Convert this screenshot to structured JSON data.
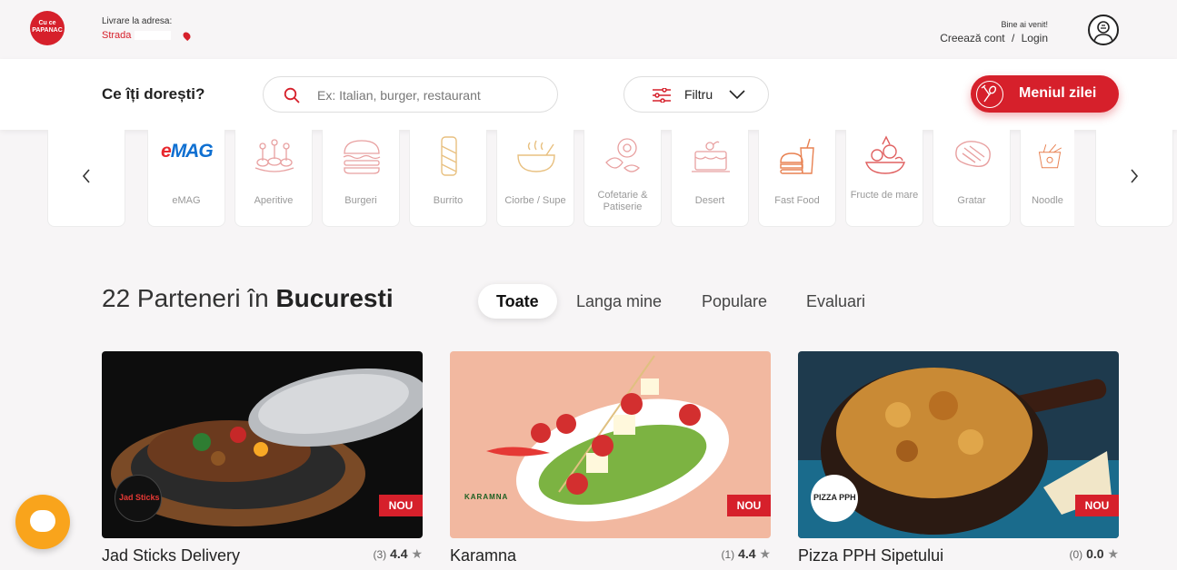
{
  "header": {
    "logo_text": "Cu ce PAPANAC",
    "delivery_label": "Livrare la adresa:",
    "delivery_address": "Strada",
    "welcome": "Bine ai venit!",
    "create_account": "Creează cont",
    "separator": "/",
    "login": "Login"
  },
  "search": {
    "question": "Ce îți dorești?",
    "placeholder": "Ex: Italian, burger, restaurant",
    "filter_label": "Filtru",
    "menu_button": "Meniul zilei"
  },
  "categories": [
    {
      "label": "eMAG",
      "icon": "emag-logo"
    },
    {
      "label": "Aperitive",
      "icon": "appetizer-skewers-icon"
    },
    {
      "label": "Burgeri",
      "icon": "burger-icon"
    },
    {
      "label": "Burrito",
      "icon": "burrito-icon"
    },
    {
      "label": "Ciorbe / Supe",
      "icon": "soup-bowl-icon"
    },
    {
      "label": "Cofetarie & Patiserie",
      "icon": "pastry-icon"
    },
    {
      "label": "Desert",
      "icon": "cake-icon"
    },
    {
      "label": "Fast Food",
      "icon": "fast-food-icon"
    },
    {
      "label": "Fructe de mare",
      "icon": "seafood-icon"
    },
    {
      "label": "Gratar",
      "icon": "steak-icon"
    },
    {
      "label": "Noodle",
      "icon": "noodle-box-icon"
    }
  ],
  "partners": {
    "count_text": "22 Parteneri în",
    "city": "Bucuresti",
    "tabs": [
      "Toate",
      "Langa mine",
      "Populare",
      "Evaluari"
    ],
    "active_tab": "Toate"
  },
  "restaurants": [
    {
      "name": "Jad Sticks Delivery",
      "reviews": "(3)",
      "rating": "4.4",
      "badge": "NOU",
      "logo_text": "Jad Sticks"
    },
    {
      "name": "Karamna",
      "reviews": "(1)",
      "rating": "4.4",
      "badge": "NOU",
      "logo_text": "KARAMNA"
    },
    {
      "name": "Pizza PPH Sipetului",
      "reviews": "(0)",
      "rating": "0.0",
      "badge": "NOU",
      "logo_text": "PIZZA PPH"
    }
  ],
  "colors": {
    "accent": "#d6202b",
    "chat": "#f9a41c",
    "background": "#f7f5f6"
  }
}
